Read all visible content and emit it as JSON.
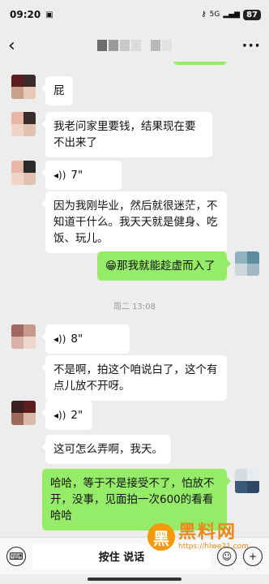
{
  "status_bar": {
    "time": "09:20",
    "network": "5G",
    "battery": "87"
  },
  "nav": {
    "back_icon": "chevron-left-icon",
    "more_icon": "ellipsis-icon",
    "more_label": "···"
  },
  "messages": [
    {
      "side": "left",
      "type": "text",
      "text": "屁"
    },
    {
      "side": "left",
      "type": "text",
      "text": "我老问家里要钱，结果现在要不出来了"
    },
    {
      "side": "left",
      "type": "voice",
      "duration": "7\""
    },
    {
      "side": "left",
      "type": "text",
      "text": "因为我刚毕业，然后就很迷茫，不知道干什么。我天天就是健身、吃饭、玩儿。"
    },
    {
      "side": "right",
      "type": "text",
      "emoji": "😁",
      "text": "那我就能趁虚而入了"
    },
    {
      "side": "left",
      "type": "voice",
      "duration": "8\""
    },
    {
      "side": "left",
      "type": "text",
      "text": "不是啊，拍这个咱说白了，这个有点儿放不开呀。"
    },
    {
      "side": "left",
      "type": "voice",
      "duration": "2\""
    },
    {
      "side": "left",
      "type": "text",
      "text": "这可怎么弄啊，我天。"
    },
    {
      "side": "right",
      "type": "text",
      "text": "哈哈，等于不是接受不了，怕放不开，没事，见面拍一次600的看看哈哈"
    }
  ],
  "time_separator": "周二 13:08",
  "composer": {
    "hold_to_talk": "按住 说话",
    "keyboard_icon": "keyboard-icon",
    "emoji_icon": "emoji-icon",
    "plus_icon": "plus-icon"
  },
  "watermark": {
    "logo_char": "黑",
    "text": "黑料网",
    "url": "https://hlwe21.com"
  },
  "colors": {
    "background": "#ededed",
    "bubble_left": "#ffffff",
    "bubble_right": "#95ec69",
    "watermark": "#e8891a"
  }
}
